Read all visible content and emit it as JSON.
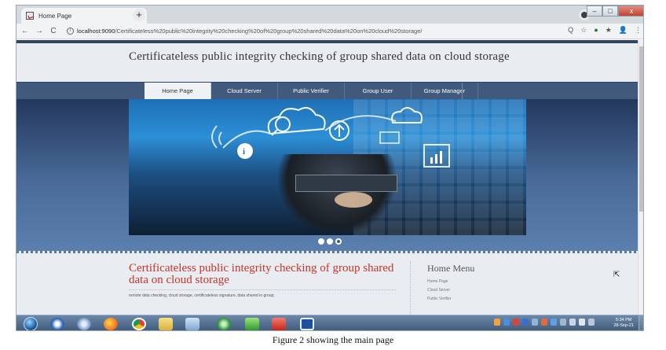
{
  "browser": {
    "tab_title": "Home Page",
    "tab_close": "×",
    "new_tab": "+",
    "url_host": "localhost:9090",
    "url_path": "/Certificateless%20public%20integrity%20checking%20of%20group%20shared%20data%20on%20cloud%20storage/",
    "back": "←",
    "forward": "→",
    "reload": "C",
    "info": "i",
    "zoom": "Q",
    "bookmark": "☆",
    "extensions": "★",
    "shield": "●",
    "profile": "👤",
    "menu": "⋮",
    "win_min": "–",
    "win_max": "□",
    "win_close": "x"
  },
  "site": {
    "title": "Certificateless public integrity checking of group shared data on cloud storage"
  },
  "nav": {
    "items": [
      "Home Page",
      "Cloud Server",
      "Public Verifier",
      "Group User",
      "Group Manager"
    ],
    "active": 0
  },
  "slider": {
    "dots": 3,
    "active": 2
  },
  "content": {
    "heading": "Certificateless public integrity checking of group shared data on cloud storage",
    "keywords": "remote data checking, cloud storage, certificateless signature, data shared in group;"
  },
  "sidebar": {
    "title": "Home Menu",
    "links": [
      "Home Page",
      "Cloud Server",
      "Public Verifier"
    ]
  },
  "taskbar": {
    "time": "5:34 PM",
    "date": "28-Sep-21"
  },
  "caption": "Figure 2 showing the main page"
}
